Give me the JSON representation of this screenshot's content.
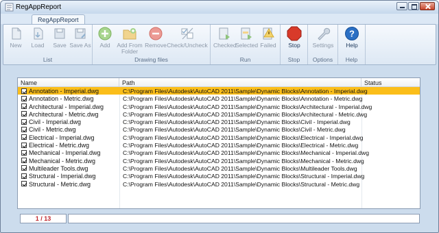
{
  "window": {
    "title": "RegAppReport"
  },
  "tabs": [
    {
      "label": "RegAppReport"
    }
  ],
  "ribbon": {
    "groups": [
      {
        "label": "List",
        "buttons": [
          "New",
          "Load",
          "Save",
          "Save As"
        ]
      },
      {
        "label": "Drawing files",
        "buttons": [
          "Add",
          "Add From Folder",
          "Remove",
          "Check/Uncheck"
        ]
      },
      {
        "label": "Run",
        "buttons": [
          "Checked",
          "Selected",
          "Failed"
        ]
      },
      {
        "label": "Stop",
        "buttons": [
          "Stop"
        ]
      },
      {
        "label": "Options",
        "buttons": [
          "Settings"
        ]
      },
      {
        "label": "Help",
        "buttons": [
          "Help"
        ]
      }
    ]
  },
  "grid": {
    "columns": [
      "Name",
      "Path",
      "Status"
    ],
    "rows": [
      {
        "name": "Annotation - Imperial.dwg",
        "path": "C:\\Program Files\\Autodesk\\AutoCAD 2011\\Sample\\Dynamic Blocks\\Annotation - Imperial.dwg",
        "status": ""
      },
      {
        "name": "Annotation - Metric.dwg",
        "path": "C:\\Program Files\\Autodesk\\AutoCAD 2011\\Sample\\Dynamic Blocks\\Annotation - Metric.dwg",
        "status": ""
      },
      {
        "name": "Architectural - Imperial.dwg",
        "path": "C:\\Program Files\\Autodesk\\AutoCAD 2011\\Sample\\Dynamic Blocks\\Architectural - Imperial.dwg",
        "status": ""
      },
      {
        "name": "Architectural - Metric.dwg",
        "path": "C:\\Program Files\\Autodesk\\AutoCAD 2011\\Sample\\Dynamic Blocks\\Architectural - Metric.dwg",
        "status": ""
      },
      {
        "name": "Civil - Imperial.dwg",
        "path": "C:\\Program Files\\Autodesk\\AutoCAD 2011\\Sample\\Dynamic Blocks\\Civil - Imperial.dwg",
        "status": ""
      },
      {
        "name": "Civil - Metric.dwg",
        "path": "C:\\Program Files\\Autodesk\\AutoCAD 2011\\Sample\\Dynamic Blocks\\Civil - Metric.dwg",
        "status": ""
      },
      {
        "name": "Electrical - Imperial.dwg",
        "path": "C:\\Program Files\\Autodesk\\AutoCAD 2011\\Sample\\Dynamic Blocks\\Electrical - Imperial.dwg",
        "status": ""
      },
      {
        "name": "Electrical - Metric.dwg",
        "path": "C:\\Program Files\\Autodesk\\AutoCAD 2011\\Sample\\Dynamic Blocks\\Electrical - Metric.dwg",
        "status": ""
      },
      {
        "name": "Mechanical - Imperial.dwg",
        "path": "C:\\Program Files\\Autodesk\\AutoCAD 2011\\Sample\\Dynamic Blocks\\Mechanical - Imperial.dwg",
        "status": ""
      },
      {
        "name": "Mechanical - Metric.dwg",
        "path": "C:\\Program Files\\Autodesk\\AutoCAD 2011\\Sample\\Dynamic Blocks\\Mechanical - Metric.dwg",
        "status": ""
      },
      {
        "name": "Multileader Tools.dwg",
        "path": "C:\\Program Files\\Autodesk\\AutoCAD 2011\\Sample\\Dynamic Blocks\\Multileader Tools.dwg",
        "status": ""
      },
      {
        "name": "Structural - Imperial.dwg",
        "path": "C:\\Program Files\\Autodesk\\AutoCAD 2011\\Sample\\Dynamic Blocks\\Structural - Imperial.dwg",
        "status": ""
      },
      {
        "name": "Structural - Metric.dwg",
        "path": "C:\\Program Files\\Autodesk\\AutoCAD 2011\\Sample\\Dynamic Blocks\\Structural - Metric.dwg",
        "status": ""
      }
    ]
  },
  "statusbar": {
    "counter": "1 / 13"
  },
  "colors": {
    "selected_row": "#fbbe1a",
    "counter_text": "#c0262c",
    "stop": "#d83a2a",
    "help": "#2b6fc4"
  }
}
